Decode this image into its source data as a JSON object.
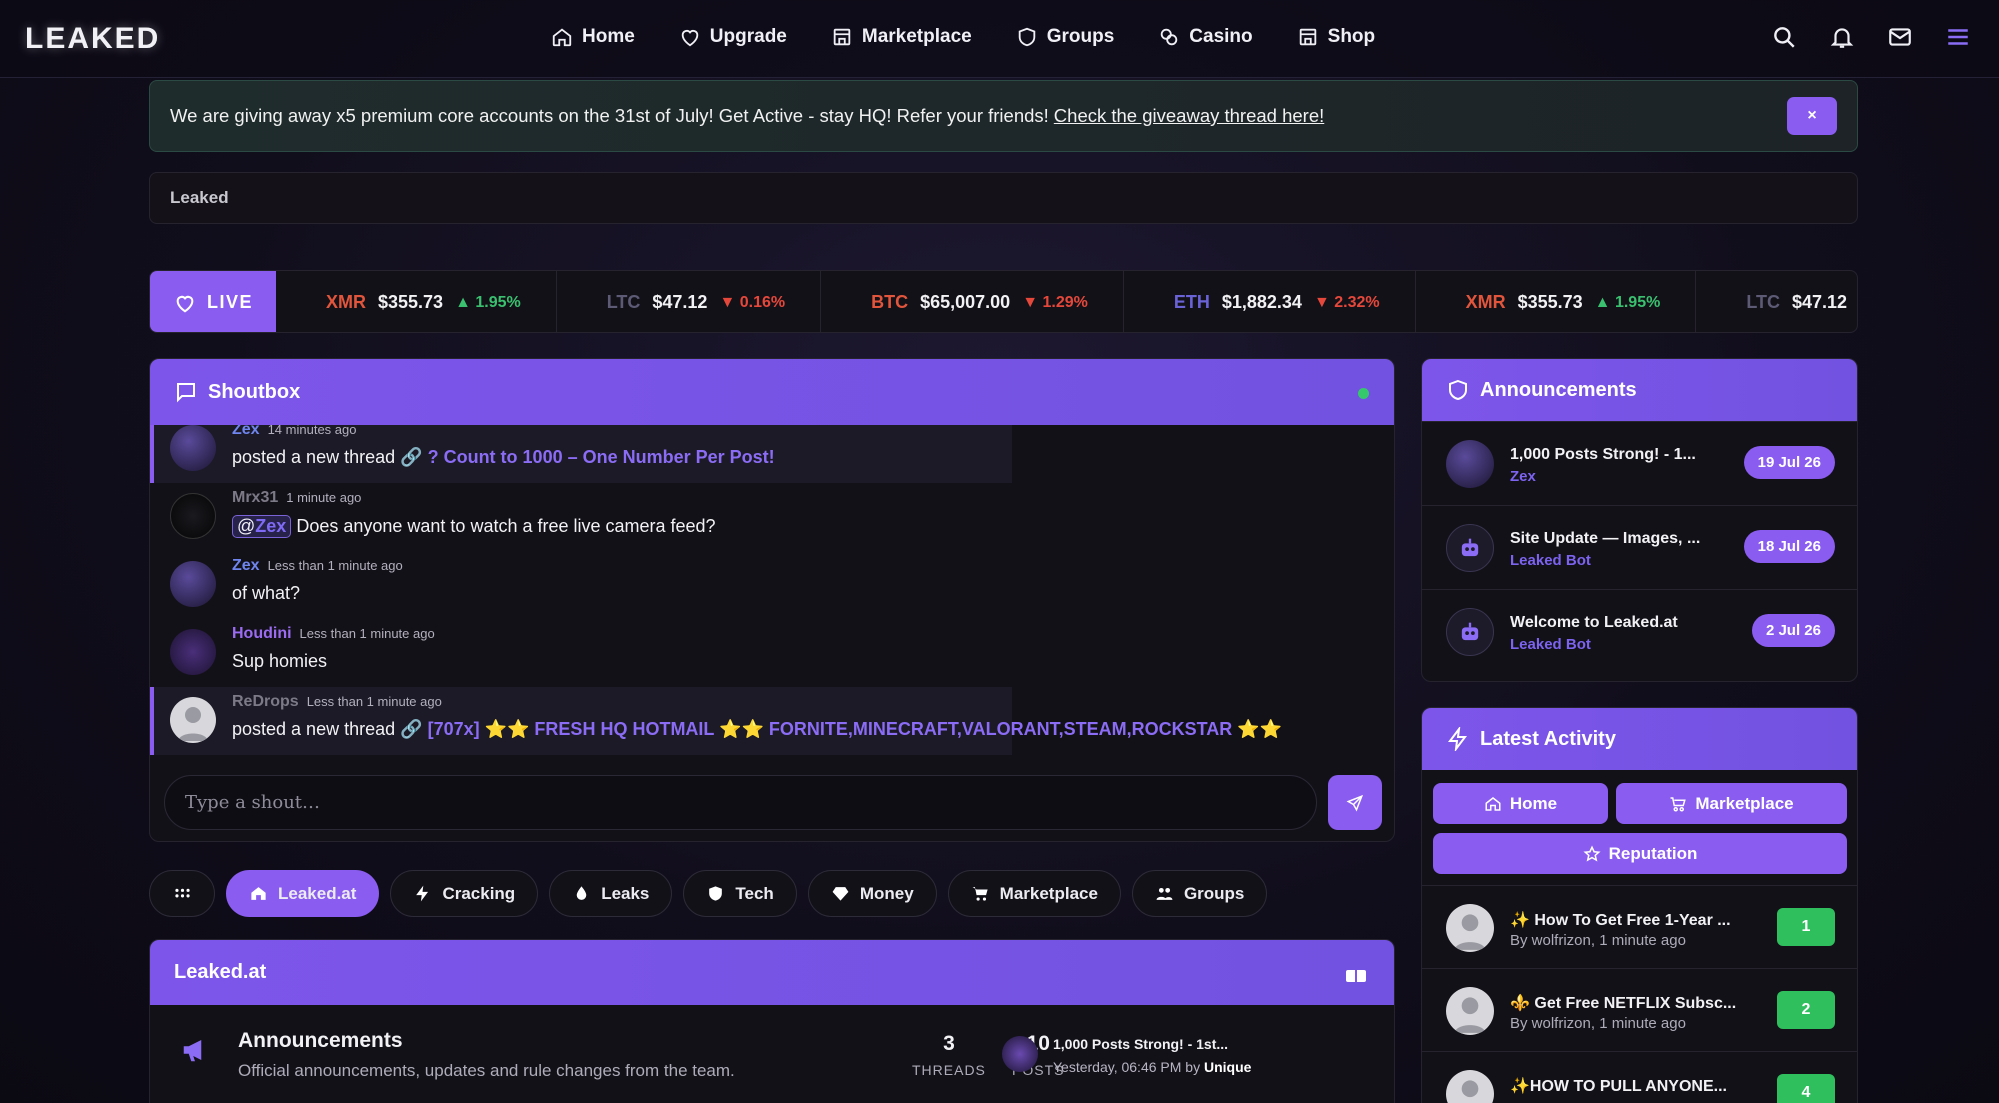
{
  "nav": {
    "logo": "LEAKED",
    "links": [
      {
        "label": "Home",
        "icon": "home-icon"
      },
      {
        "label": "Upgrade",
        "icon": "diamond-icon"
      },
      {
        "label": "Marketplace",
        "icon": "store-icon"
      },
      {
        "label": "Groups",
        "icon": "shield-icon"
      },
      {
        "label": "Casino",
        "icon": "coins-icon"
      },
      {
        "label": "Shop",
        "icon": "store-icon"
      }
    ],
    "right_icons": [
      "search-icon",
      "bell-icon",
      "mail-icon",
      "menu-icon"
    ]
  },
  "banner": {
    "text": "We are giving away x5 premium core accounts on the 31st of July! Get Active - stay HQ! Refer your friends!",
    "link": "Check the giveaway thread here!",
    "close": "×"
  },
  "breadcrumb": "Leaked",
  "ticker": {
    "live_label": "LIVE",
    "items": [
      {
        "sym": "XMR",
        "price": "$355.73",
        "change": "▲ 1.95%",
        "dir": "up",
        "color": "#e1553c"
      },
      {
        "sym": "LTC",
        "price": "$47.12",
        "change": "▼ 0.16%",
        "dir": "down",
        "color": "#5c5a75"
      },
      {
        "sym": "BTC",
        "price": "$65,007.00",
        "change": "▼ 1.29%",
        "dir": "down",
        "color": "#e1553c"
      },
      {
        "sym": "ETH",
        "price": "$1,882.34",
        "change": "▼ 2.32%",
        "dir": "down",
        "color": "#6a63d8"
      },
      {
        "sym": "XMR",
        "price": "$355.73",
        "change": "▲ 1.95%",
        "dir": "up",
        "color": "#e1553c"
      },
      {
        "sym": "LTC",
        "price": "$47.12",
        "change": "▼ 0.16%",
        "dir": "down",
        "color": "#5c5a75"
      }
    ]
  },
  "shoutbox": {
    "title": "Shoutbox",
    "placeholder": "Type a shout…",
    "shouts": [
      {
        "user": "Zex",
        "time": "14 minutes ago",
        "prefix": "posted a new thread",
        "thread": "? Count to 1000 – One Number Per Post!",
        "color": "#6f86f0"
      },
      {
        "user": "Mrx31",
        "time": "1 minute ago",
        "mention": "Zex",
        "text": "Does anyone want to watch a free live camera feed?",
        "color": "#7d7a87"
      },
      {
        "user": "Zex",
        "time": "Less than 1 minute ago",
        "text": "of what?",
        "color": "#6f86f0"
      },
      {
        "user": "Houdini",
        "time": "Less than 1 minute ago",
        "text": "Sup homies",
        "color": "#9b6cf2"
      },
      {
        "user": "ReDrops",
        "time": "Less than 1 minute ago",
        "prefix": "posted a new thread",
        "thread": "[707x] ⭐⭐ FRESH HQ HOTMAIL ⭐⭐ FORNITE,MINECRAFT,VALORANT,STEAM,ROCKSTAR ⭐⭐",
        "color": "#7d7a87"
      }
    ]
  },
  "categories": [
    {
      "label": "Leaked.at",
      "icon": "home-icon",
      "active": true
    },
    {
      "label": "Cracking",
      "icon": "bolt-icon",
      "active": false
    },
    {
      "label": "Leaks",
      "icon": "drop-icon",
      "active": false
    },
    {
      "label": "Tech",
      "icon": "shield-icon",
      "active": false
    },
    {
      "label": "Money",
      "icon": "gem-icon",
      "active": false
    },
    {
      "label": "Marketplace",
      "icon": "cart-icon",
      "active": false
    },
    {
      "label": "Groups",
      "icon": "users-icon",
      "active": false
    }
  ],
  "forum": {
    "section_title": "Leaked.at",
    "forum_title": "Announcements",
    "forum_desc": "Official announcements, updates and rule changes from the team.",
    "threads": "3",
    "threads_label": "THREADS",
    "posts": "10",
    "posts_label": "POSTS",
    "last_title": "1,000 Posts Strong! - 1st...",
    "last_meta": "Yesterday, 06:46 PM by",
    "last_user": "Unique"
  },
  "announcements": {
    "title": "Announcements",
    "items": [
      {
        "title": "1,000 Posts Strong! - 1...",
        "author": "Zex",
        "date": "19 Jul 26"
      },
      {
        "title": "Site Update — Images, ...",
        "author": "Leaked Bot",
        "date": "18 Jul 26"
      },
      {
        "title": "Welcome to Leaked.at",
        "author": "Leaked Bot",
        "date": "2 Jul 26"
      }
    ]
  },
  "activity": {
    "title": "Latest Activity",
    "tabs": [
      "Home",
      "Marketplace",
      "Reputation"
    ],
    "items": [
      {
        "title": "✨ How To Get Free 1-Year ...",
        "meta": "By wolfrizon, 1 minute ago",
        "count": "1"
      },
      {
        "title": "⚜️ Get Free NETFLIX Subsc...",
        "meta": "By wolfrizon, 1 minute ago",
        "count": "2"
      },
      {
        "title": "✨HOW TO PULL ANYONE...",
        "meta": "",
        "count": "4"
      }
    ]
  },
  "colors": {
    "accent": "#8a5cf0",
    "up": "#3ac16f",
    "down": "#e5483b",
    "online": "#35c96c"
  }
}
